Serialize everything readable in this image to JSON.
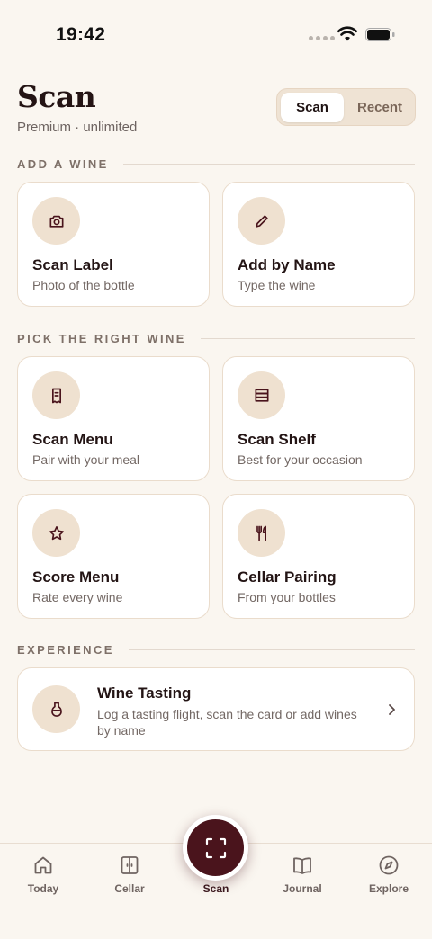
{
  "status_bar": {
    "time": "19:42"
  },
  "header": {
    "title": "Scan",
    "subtitle": "Premium · unlimited",
    "segments": [
      "Scan",
      "Recent"
    ]
  },
  "sections": {
    "add": "ADD A WINE",
    "pick": "PICK THE RIGHT WINE",
    "experience": "EXPERIENCE"
  },
  "cards": [
    {
      "title": "Scan Label",
      "sub": "Photo of the bottle",
      "icon": "camera-icon"
    },
    {
      "title": "Add by Name",
      "sub": "Type the wine",
      "icon": "pencil-icon"
    },
    {
      "title": "Scan Menu",
      "sub": "Pair with your meal",
      "icon": "receipt-icon"
    },
    {
      "title": "Scan Shelf",
      "sub": "Best for your occasion",
      "icon": "shelf-icon"
    },
    {
      "title": "Score Menu",
      "sub": "Rate every wine",
      "icon": "star-icon"
    },
    {
      "title": "Cellar Pairing",
      "sub": "From your bottles",
      "icon": "utensils-icon"
    }
  ],
  "tasting": {
    "title": "Wine Tasting",
    "sub": "Log a tasting flight, scan the card or add wines by name",
    "icon": "wine-glass-icon"
  },
  "tabs": [
    {
      "label": "Today",
      "icon": "home-icon"
    },
    {
      "label": "Cellar",
      "icon": "cabinet-icon"
    },
    {
      "label": "Scan",
      "icon": "scan-icon"
    },
    {
      "label": "Journal",
      "icon": "book-icon"
    },
    {
      "label": "Explore",
      "icon": "compass-icon"
    }
  ],
  "colors": {
    "background": "#faf6f0",
    "accent": "#4a141c",
    "icon_circle": "#efe1d0",
    "card_border": "#eadccc"
  }
}
